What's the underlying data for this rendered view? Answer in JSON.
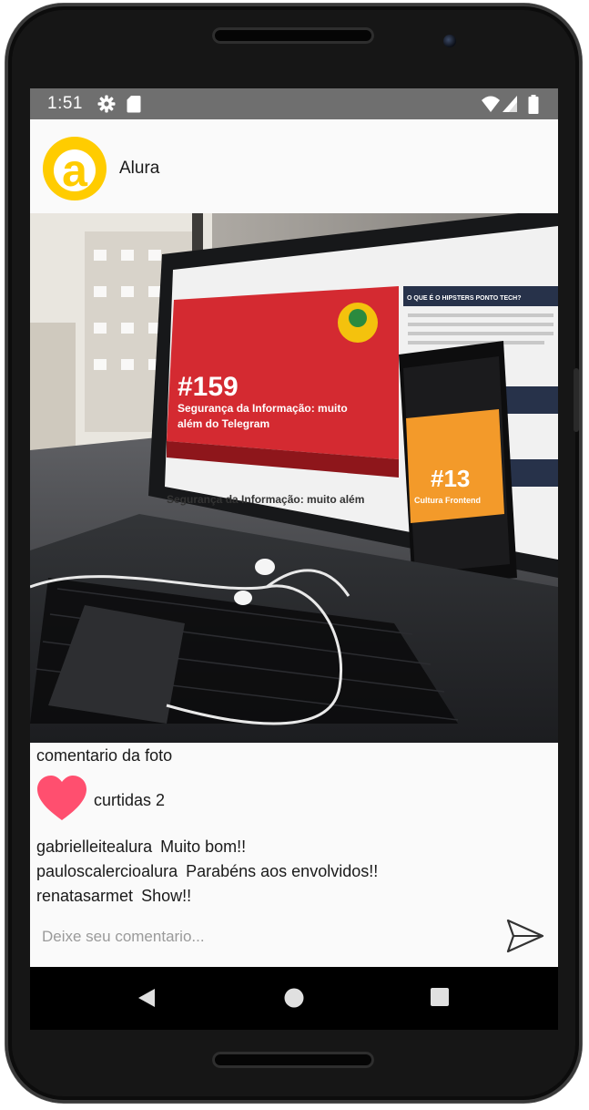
{
  "status_bar": {
    "time": "1:51",
    "icons": [
      "settings-icon",
      "sd-card-icon",
      "wifi-icon",
      "signal-icon",
      "battery-icon"
    ]
  },
  "profile": {
    "avatar_letter": "a",
    "avatar_color": "#ffcc00",
    "name": "Alura"
  },
  "post": {
    "photo_subject": "laptop-and-phone-photo",
    "photo_texts": {
      "laptop_episode": "#159",
      "laptop_title_line1": "Segurança da Informação: muito",
      "laptop_title_line2": "além do Telegram",
      "laptop_sidebar": "O QUE É O HIPSTERS PONTO TECH?",
      "laptop_lower_title": "Segurança da Informação: muito além",
      "phone_episode": "#13",
      "phone_title": "Cultura Frontend"
    },
    "caption": "comentario da foto",
    "likes_text": "curtidas 2",
    "like_color": "#ff4f6f",
    "comments": [
      {
        "user": "gabrielleitealura",
        "text": "Muito bom!!"
      },
      {
        "user": "pauloscalercioalura",
        "text": "Parabéns aos envolvidos!!"
      },
      {
        "user": "renatasarmet",
        "text": "Show!!"
      }
    ]
  },
  "comment_box": {
    "placeholder": "Deixe seu comentario..."
  },
  "nav": {
    "buttons": [
      "back-icon",
      "home-icon",
      "recents-icon"
    ]
  }
}
